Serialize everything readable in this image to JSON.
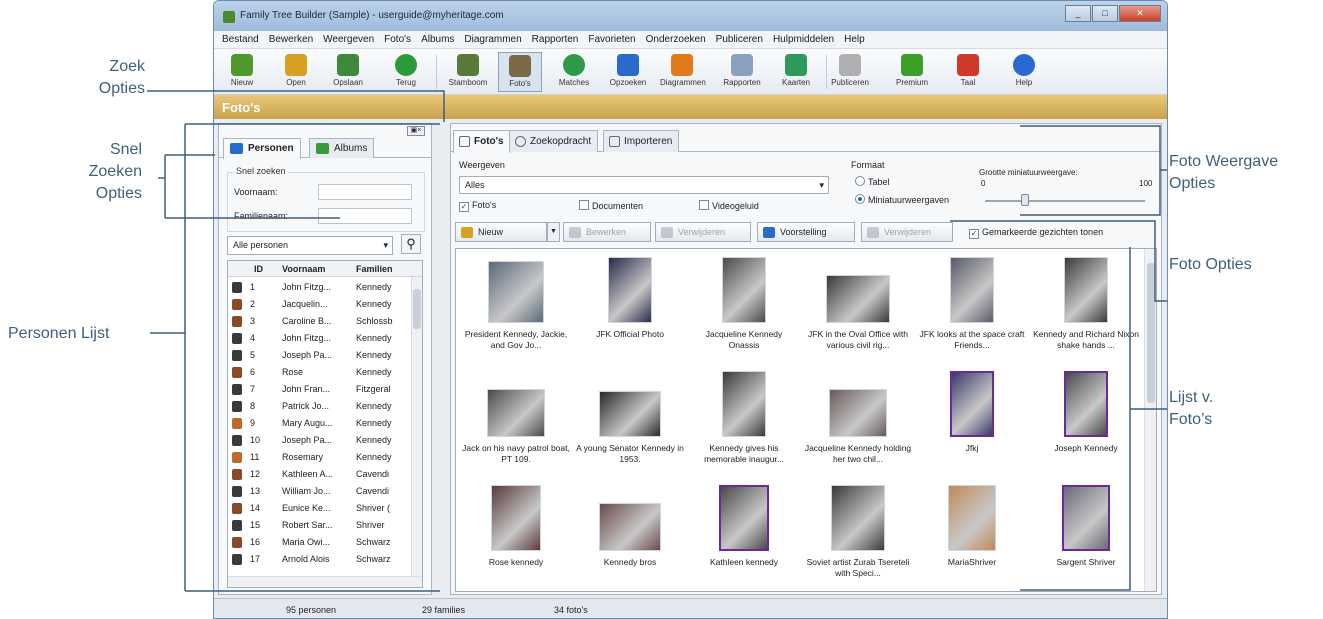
{
  "window": {
    "title": "Family Tree Builder (Sample) - userguide@myheritage.com",
    "buttons": [
      "_",
      "□",
      "✕"
    ]
  },
  "menu": [
    "Bestand",
    "Bewerken",
    "Weergeven",
    "Foto's",
    "Albums",
    "Diagrammen",
    "Rapporten",
    "Favorieten",
    "Onderzoeken",
    "Publiceren",
    "Hulpmiddelen",
    "Help"
  ],
  "toolbar": [
    {
      "label": "Nieuw",
      "icon": "new-icon",
      "color": "#4f9a2c"
    },
    {
      "label": "Open",
      "icon": "open-icon",
      "color": "#d6a023"
    },
    {
      "label": "Opslaan",
      "icon": "save-icon",
      "color": "#3c8a3a"
    },
    {
      "label": "Terug",
      "icon": "back-icon",
      "color": "#2a9a3a"
    },
    {
      "label": "Stamboom",
      "icon": "family-tree-icon",
      "color": "#5a7a3a"
    },
    {
      "label": "Foto's",
      "icon": "photos-icon",
      "color": "#7a6a4a"
    },
    {
      "label": "Matches",
      "icon": "matches-icon",
      "color": "#2e9a4a"
    },
    {
      "label": "Opzoeken",
      "icon": "lookup-icon",
      "color": "#2a6ac8"
    },
    {
      "label": "Diagrammen",
      "icon": "charts-icon",
      "color": "#e07a1a"
    },
    {
      "label": "Rapporten",
      "icon": "reports-icon",
      "color": "#8aa0c0"
    },
    {
      "label": "Kaarten",
      "icon": "maps-icon",
      "color": "#2e9a5a"
    },
    {
      "label": "Publiceren",
      "icon": "publish-icon",
      "color": "#b0b0b0"
    },
    {
      "label": "Premium",
      "icon": "premium-icon",
      "color": "#3aa02a"
    },
    {
      "label": "Taal",
      "icon": "language-icon",
      "color": "#d03a2a"
    },
    {
      "label": "Help",
      "icon": "help-icon",
      "color": "#2a6ad0"
    }
  ],
  "section_title": "Foto's",
  "left_tabs": [
    {
      "label": "Personen",
      "icon": "persons-icon",
      "color": "#2a6ac8"
    },
    {
      "label": "Albums",
      "icon": "albums-icon",
      "color": "#3a9a3a"
    }
  ],
  "snel_zoeken": {
    "legend": "Snel zoeken",
    "first_name_label": "Voornaam:",
    "last_name_label": "Familienaam:"
  },
  "persons_filter": "Alle personen",
  "person_columns": [
    "ID",
    "Voornaam",
    "Familien"
  ],
  "persons": [
    {
      "id": "1",
      "first": "John Fitzg...",
      "last": "Kennedy",
      "color": "#3a3a3a"
    },
    {
      "id": "2",
      "first": "Jacquelin...",
      "last": "Kennedy",
      "color": "#8a4a2a"
    },
    {
      "id": "3",
      "first": "Caroline B...",
      "last": "Schlossb",
      "color": "#8a4a2a"
    },
    {
      "id": "4",
      "first": "John Fitzg...",
      "last": "Kennedy",
      "color": "#3a3a3a"
    },
    {
      "id": "5",
      "first": "Joseph Pa...",
      "last": "Kennedy",
      "color": "#3a3a3a"
    },
    {
      "id": "6",
      "first": "Rose",
      "last": "Kennedy",
      "color": "#8a4a2a"
    },
    {
      "id": "7",
      "first": "John Fran...",
      "last": "Fitzgeral",
      "color": "#3a3a3a"
    },
    {
      "id": "8",
      "first": "Patrick Jo...",
      "last": "Kennedy",
      "color": "#3a3a3a"
    },
    {
      "id": "9",
      "first": "Mary Augu...",
      "last": "Kennedy",
      "color": "#c06a2a"
    },
    {
      "id": "10",
      "first": "Joseph Pa...",
      "last": "Kennedy",
      "color": "#3a3a3a"
    },
    {
      "id": "11",
      "first": "Rosemary",
      "last": "Kennedy",
      "color": "#c06a2a"
    },
    {
      "id": "12",
      "first": "Kathleen A...",
      "last": "Cavendi",
      "color": "#8a4a2a"
    },
    {
      "id": "13",
      "first": "William Jo...",
      "last": "Cavendi",
      "color": "#3a3a3a"
    },
    {
      "id": "14",
      "first": "Eunice Ke...",
      "last": "Shriver (",
      "color": "#8a4a2a"
    },
    {
      "id": "15",
      "first": "Robert Sar...",
      "last": "Shriver",
      "color": "#3a3a3a"
    },
    {
      "id": "16",
      "first": "Maria Owi...",
      "last": "Schwarz",
      "color": "#8a4a2a"
    },
    {
      "id": "17",
      "first": "Arnold Alois",
      "last": "Schwarz",
      "color": "#3a3a3a"
    }
  ],
  "right_tabs": [
    {
      "label": "Foto's"
    },
    {
      "label": "Zoekopdracht"
    },
    {
      "label": "Importeren"
    }
  ],
  "weergeven": {
    "label": "Weergeven",
    "selected": "Alles",
    "checkboxes": [
      {
        "label": "Foto's",
        "checked": true
      },
      {
        "label": "Documenten",
        "checked": false
      },
      {
        "label": "Videogeluid",
        "checked": false
      }
    ]
  },
  "formaat": {
    "label": "Formaat",
    "options": [
      {
        "label": "Tabel",
        "selected": false
      },
      {
        "label": "Miniatuurweergaven",
        "selected": true
      }
    ],
    "size_label": "Grootte miniatuurweergave:",
    "size_min": "0",
    "size_max": "100",
    "size_value": 25
  },
  "photo_toolbar": [
    {
      "label": "Nieuw",
      "disabled": false,
      "has_dropdown": true,
      "color": "#d6a023"
    },
    {
      "label": "Bewerken",
      "disabled": true,
      "color": "#7a8a9a"
    },
    {
      "label": "Verwijderen",
      "disabled": true,
      "color": "#7a8a9a"
    },
    {
      "label": "Voorstelling",
      "disabled": false,
      "color": "#2a6ac8"
    },
    {
      "label": "Verwijderen",
      "disabled": true,
      "color": "#7a8a9a"
    }
  ],
  "show_marked_faces": {
    "label": "Gemarkeerde gezichten tonen",
    "checked": true
  },
  "photos": [
    {
      "caption": "President Kennedy, Jackie, and Gov Jo...",
      "color": "#5a6a7a",
      "tagged": false
    },
    {
      "caption": "JFK Official Photo",
      "color": "#2a2a4a",
      "tagged": false
    },
    {
      "caption": "Jacqueline Kennedy Onassis",
      "color": "#4a4a4a",
      "tagged": false
    },
    {
      "caption": "JFK in the Oval Office with various civil rig...",
      "color": "#3a3a3a",
      "tagged": false
    },
    {
      "caption": "JFK looks at the space craft Friends...",
      "color": "#5a5a6a",
      "tagged": false
    },
    {
      "caption": "Kennedy and Richard Nixon shake hands ...",
      "color": "#3a3a3a",
      "tagged": false
    },
    {
      "caption": "Jack on his navy patrol boat, PT 109.",
      "color": "#4a4a4a",
      "tagged": false
    },
    {
      "caption": "A young Senator Kennedy in 1953.",
      "color": "#2a2a2a",
      "tagged": false
    },
    {
      "caption": "Kennedy gives his memorable inaugur...",
      "color": "#3a3a3a",
      "tagged": false
    },
    {
      "caption": "Jacqueline Kennedy holding her two chil...",
      "color": "#6a5a5a",
      "tagged": false
    },
    {
      "caption": "Jfkj",
      "color": "#3a3a6a",
      "tagged": true
    },
    {
      "caption": "Joseph Kennedy",
      "color": "#4a4a4a",
      "tagged": true
    },
    {
      "caption": "Rose kennedy",
      "color": "#5a3a3a",
      "tagged": false
    },
    {
      "caption": "Kennedy bros",
      "color": "#6a4a4a",
      "tagged": false
    },
    {
      "caption": "Kathleen kennedy",
      "color": "#4a4a4a",
      "tagged": true
    },
    {
      "caption": "Soviet artist Zurab Tsereteli with Speci...",
      "color": "#3a3a3a",
      "tagged": false
    },
    {
      "caption": "MariaShriver",
      "color": "#c08a5a",
      "tagged": false
    },
    {
      "caption": "Sargent Shriver",
      "color": "#6a6a7a",
      "tagged": true
    }
  ],
  "status": {
    "persons": "95 personen",
    "families": "29 families",
    "photos": "34 foto's"
  },
  "callouts": {
    "zoek_opties": [
      "Zoek",
      "Opties"
    ],
    "snel_zoeken_opties": [
      "Snel",
      "Zoeken",
      "Opties"
    ],
    "personen_lijst": "Personen Lijst",
    "foto_weergave_opties": [
      "Foto Weergave",
      "Opties"
    ],
    "foto_opties": "Foto Opties",
    "lijst_fotos": [
      "Lijst v.",
      "Foto’s"
    ]
  }
}
